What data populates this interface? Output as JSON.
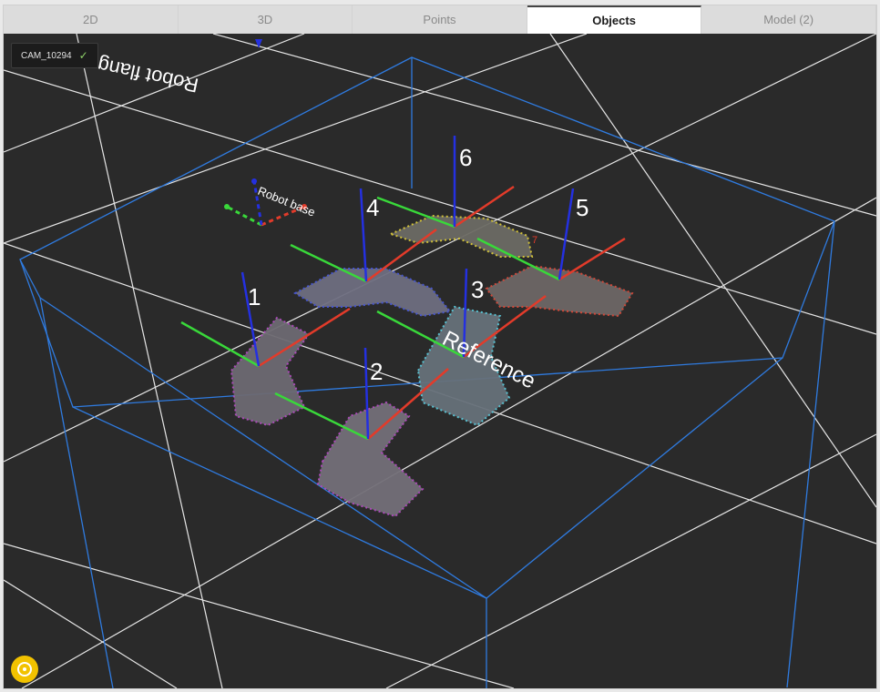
{
  "tabs": [
    {
      "label": "2D",
      "active": false
    },
    {
      "label": "3D",
      "active": false
    },
    {
      "label": "Points",
      "active": false
    },
    {
      "label": "Objects",
      "active": true
    },
    {
      "label": "Model (2)",
      "active": false
    }
  ],
  "camera": {
    "label": "CAM_10294",
    "status_icon": "check-icon"
  },
  "scene": {
    "robot_flange_label": "Robot flange",
    "robot_base_label": "Robot base",
    "reference_label": "Reference",
    "object_labels": [
      "1",
      "2",
      "3",
      "4",
      "5",
      "6"
    ],
    "extra_label": "7"
  },
  "colors": {
    "background": "#2a2a2a",
    "grid": "#e6e6e6",
    "box": "#2f7be0",
    "axis_x": "#e23b2a",
    "axis_y": "#39d83a",
    "axis_z": "#2430e0",
    "shutter": "#f2c200"
  }
}
